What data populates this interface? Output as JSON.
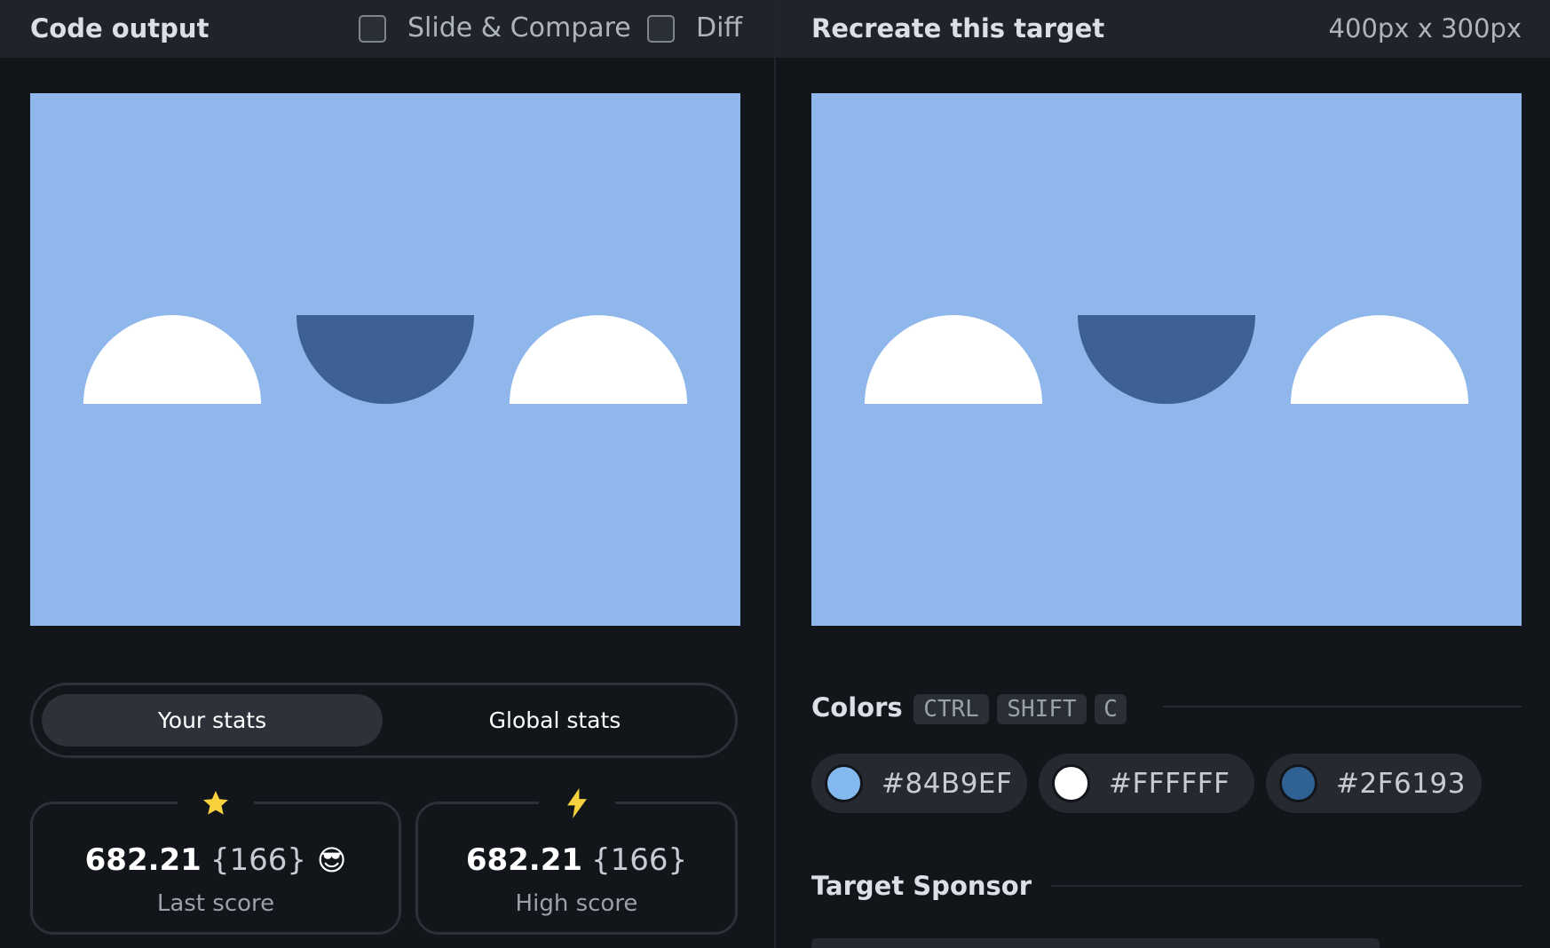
{
  "left_header": {
    "title": "Code output",
    "slide_compare_label": "Slide & Compare",
    "diff_label": "Diff"
  },
  "right_header": {
    "title": "Recreate this target",
    "dimensions": "400px x 300px"
  },
  "stats_tabs": {
    "your_stats": "Your stats",
    "global_stats": "Global stats",
    "active": "your_stats"
  },
  "scores": {
    "last": {
      "icon": "star-icon",
      "value": "682.21",
      "count": "{166}",
      "emoji": "😎",
      "label": "Last score"
    },
    "high": {
      "icon": "lightning-icon",
      "value": "682.21",
      "count": "{166}",
      "label": "High score"
    }
  },
  "colors_section": {
    "title": "Colors",
    "shortcut_keys": [
      "CTRL",
      "SHIFT",
      "C"
    ],
    "swatches": [
      {
        "hex": "#84B9EF",
        "label": "#84B9EF"
      },
      {
        "hex": "#FFFFFF",
        "label": "#FFFFFF"
      },
      {
        "hex": "#2F6193",
        "label": "#2F6193"
      }
    ]
  },
  "sponsor_section": {
    "title": "Target Sponsor"
  },
  "canvas": {
    "background": "#8FB7EB",
    "light_shape": "#FFFFFF",
    "dark_shape": "#3C6192"
  },
  "theme": {
    "accent_yellow": "#F7D23E"
  }
}
